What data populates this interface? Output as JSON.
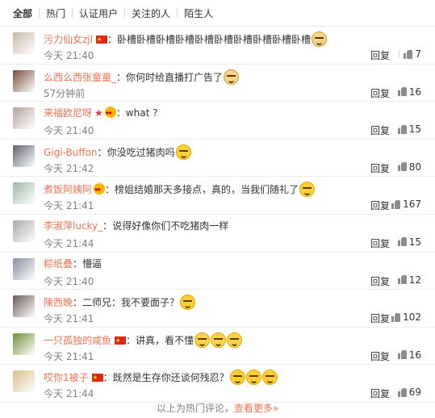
{
  "tabs": [
    "全部",
    "热门",
    "认证用户",
    "关注的人",
    "陌生人"
  ],
  "comments": [
    {
      "user": "污力仙女zjl",
      "badges": [
        "flag"
      ],
      "text": "卧槽卧槽卧槽卧槽卧槽卧槽卧槽卧槽卧槽卧槽",
      "emojis": [
        "dog"
      ],
      "time": "今天 21:40",
      "likes": "7",
      "avatar": "#c9b9a8"
    },
    {
      "user": "么西么西张童童_",
      "badges": [],
      "text": "你何时给直播打广告了",
      "emojis": [
        "dog"
      ],
      "time": "57分钟前",
      "likes": "16",
      "avatar": "#7a4a3c"
    },
    {
      "user": "来福欧尼呀",
      "badges": [
        "medal",
        "eyes"
      ],
      "text": "what ?",
      "emojis": [],
      "time": "今天 21:40",
      "likes": "15",
      "avatar": "#b8a2a0"
    },
    {
      "user": "Gigi-Buffon",
      "badges": [],
      "text": "你没吃过猪肉吗",
      "emojis": [
        "smile"
      ],
      "time": "今天 21:42",
      "likes": "80",
      "avatar": "#5d6470"
    },
    {
      "user": "煮饭阿姨阿",
      "badges": [
        "eyes"
      ],
      "text": "榜姐结婚那天多接点，真的，当我们随礼了",
      "emojis": [
        "smile"
      ],
      "time": "今天 21:41",
      "likes": "167",
      "avatar": "#9fb7a8"
    },
    {
      "user": "李淑萍lucky_",
      "badges": [],
      "text": "说得好像你们不吃猪肉一样",
      "emojis": [],
      "time": "今天 21:44",
      "likes": "15",
      "avatar": "#a9a9a9"
    },
    {
      "user": "粽纸叠",
      "badges": [],
      "text": "懵逼",
      "emojis": [],
      "time": "今天 21:40",
      "likes": "12",
      "avatar": "#888fa3"
    },
    {
      "user": "陳西晚",
      "badges": [],
      "text": "二师兄：我不要面子？",
      "emojis": [
        "smile"
      ],
      "time": "今天 21:41",
      "likes": "102",
      "avatar": "#6a5a55"
    },
    {
      "user": "一只孤独的咸鱼",
      "badges": [
        "flag"
      ],
      "text": "讲真，看不懂",
      "emojis": [
        "drool",
        "drool",
        "drool"
      ],
      "time": "今天 21:41",
      "likes": "16",
      "avatar": "#6f8f3a"
    },
    {
      "user": "哎你1被子",
      "badges": [
        "flag"
      ],
      "text": "既然是生存你还谈何残忍？",
      "emojis": [
        "smile",
        "smile",
        "smile"
      ],
      "time": "今天 21:44",
      "likes": "69",
      "avatar": "#d8c08a"
    }
  ],
  "reply_label": "回复",
  "footer": {
    "prefix": "以上为热门评论，",
    "more": "查看更多»"
  },
  "colors": {
    "username": "#eb7350",
    "link": "#eb7350"
  }
}
